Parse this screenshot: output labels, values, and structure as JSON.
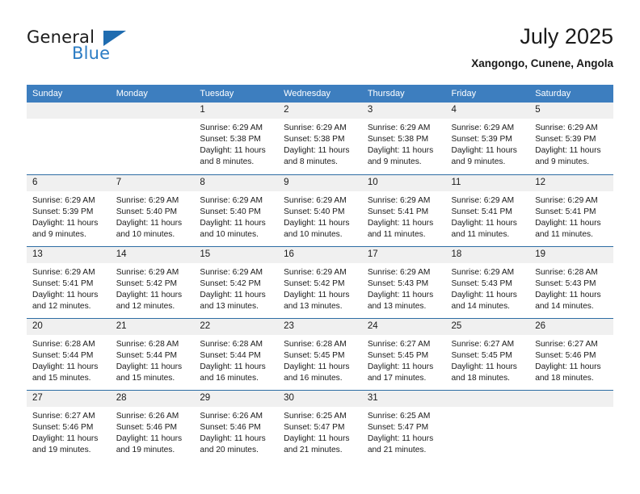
{
  "brand": {
    "line1": "General",
    "line2": "Blue",
    "triangle_icon": "brand-triangle-icon",
    "color_dark": "#1c1c1c",
    "color_blue": "#2b7cc4"
  },
  "header": {
    "title": "July 2025",
    "subtitle": "Xangongo, Cunene, Angola"
  },
  "theme": {
    "header_blue": "#3d7ebf",
    "row_rule_blue": "#2e6da4",
    "daynum_band": "#f0f0f0",
    "text": "#1a1a1a"
  },
  "calendar": {
    "weekday_headers": [
      "Sunday",
      "Monday",
      "Tuesday",
      "Wednesday",
      "Thursday",
      "Friday",
      "Saturday"
    ],
    "weeks": [
      [
        {
          "day": ""
        },
        {
          "day": ""
        },
        {
          "day": "1",
          "sunrise": "Sunrise: 6:29 AM",
          "sunset": "Sunset: 5:38 PM",
          "daylight": "Daylight: 11 hours and 8 minutes."
        },
        {
          "day": "2",
          "sunrise": "Sunrise: 6:29 AM",
          "sunset": "Sunset: 5:38 PM",
          "daylight": "Daylight: 11 hours and 8 minutes."
        },
        {
          "day": "3",
          "sunrise": "Sunrise: 6:29 AM",
          "sunset": "Sunset: 5:38 PM",
          "daylight": "Daylight: 11 hours and 9 minutes."
        },
        {
          "day": "4",
          "sunrise": "Sunrise: 6:29 AM",
          "sunset": "Sunset: 5:39 PM",
          "daylight": "Daylight: 11 hours and 9 minutes."
        },
        {
          "day": "5",
          "sunrise": "Sunrise: 6:29 AM",
          "sunset": "Sunset: 5:39 PM",
          "daylight": "Daylight: 11 hours and 9 minutes."
        }
      ],
      [
        {
          "day": "6",
          "sunrise": "Sunrise: 6:29 AM",
          "sunset": "Sunset: 5:39 PM",
          "daylight": "Daylight: 11 hours and 9 minutes."
        },
        {
          "day": "7",
          "sunrise": "Sunrise: 6:29 AM",
          "sunset": "Sunset: 5:40 PM",
          "daylight": "Daylight: 11 hours and 10 minutes."
        },
        {
          "day": "8",
          "sunrise": "Sunrise: 6:29 AM",
          "sunset": "Sunset: 5:40 PM",
          "daylight": "Daylight: 11 hours and 10 minutes."
        },
        {
          "day": "9",
          "sunrise": "Sunrise: 6:29 AM",
          "sunset": "Sunset: 5:40 PM",
          "daylight": "Daylight: 11 hours and 10 minutes."
        },
        {
          "day": "10",
          "sunrise": "Sunrise: 6:29 AM",
          "sunset": "Sunset: 5:41 PM",
          "daylight": "Daylight: 11 hours and 11 minutes."
        },
        {
          "day": "11",
          "sunrise": "Sunrise: 6:29 AM",
          "sunset": "Sunset: 5:41 PM",
          "daylight": "Daylight: 11 hours and 11 minutes."
        },
        {
          "day": "12",
          "sunrise": "Sunrise: 6:29 AM",
          "sunset": "Sunset: 5:41 PM",
          "daylight": "Daylight: 11 hours and 11 minutes."
        }
      ],
      [
        {
          "day": "13",
          "sunrise": "Sunrise: 6:29 AM",
          "sunset": "Sunset: 5:41 PM",
          "daylight": "Daylight: 11 hours and 12 minutes."
        },
        {
          "day": "14",
          "sunrise": "Sunrise: 6:29 AM",
          "sunset": "Sunset: 5:42 PM",
          "daylight": "Daylight: 11 hours and 12 minutes."
        },
        {
          "day": "15",
          "sunrise": "Sunrise: 6:29 AM",
          "sunset": "Sunset: 5:42 PM",
          "daylight": "Daylight: 11 hours and 13 minutes."
        },
        {
          "day": "16",
          "sunrise": "Sunrise: 6:29 AM",
          "sunset": "Sunset: 5:42 PM",
          "daylight": "Daylight: 11 hours and 13 minutes."
        },
        {
          "day": "17",
          "sunrise": "Sunrise: 6:29 AM",
          "sunset": "Sunset: 5:43 PM",
          "daylight": "Daylight: 11 hours and 13 minutes."
        },
        {
          "day": "18",
          "sunrise": "Sunrise: 6:29 AM",
          "sunset": "Sunset: 5:43 PM",
          "daylight": "Daylight: 11 hours and 14 minutes."
        },
        {
          "day": "19",
          "sunrise": "Sunrise: 6:28 AM",
          "sunset": "Sunset: 5:43 PM",
          "daylight": "Daylight: 11 hours and 14 minutes."
        }
      ],
      [
        {
          "day": "20",
          "sunrise": "Sunrise: 6:28 AM",
          "sunset": "Sunset: 5:44 PM",
          "daylight": "Daylight: 11 hours and 15 minutes."
        },
        {
          "day": "21",
          "sunrise": "Sunrise: 6:28 AM",
          "sunset": "Sunset: 5:44 PM",
          "daylight": "Daylight: 11 hours and 15 minutes."
        },
        {
          "day": "22",
          "sunrise": "Sunrise: 6:28 AM",
          "sunset": "Sunset: 5:44 PM",
          "daylight": "Daylight: 11 hours and 16 minutes."
        },
        {
          "day": "23",
          "sunrise": "Sunrise: 6:28 AM",
          "sunset": "Sunset: 5:45 PM",
          "daylight": "Daylight: 11 hours and 16 minutes."
        },
        {
          "day": "24",
          "sunrise": "Sunrise: 6:27 AM",
          "sunset": "Sunset: 5:45 PM",
          "daylight": "Daylight: 11 hours and 17 minutes."
        },
        {
          "day": "25",
          "sunrise": "Sunrise: 6:27 AM",
          "sunset": "Sunset: 5:45 PM",
          "daylight": "Daylight: 11 hours and 18 minutes."
        },
        {
          "day": "26",
          "sunrise": "Sunrise: 6:27 AM",
          "sunset": "Sunset: 5:46 PM",
          "daylight": "Daylight: 11 hours and 18 minutes."
        }
      ],
      [
        {
          "day": "27",
          "sunrise": "Sunrise: 6:27 AM",
          "sunset": "Sunset: 5:46 PM",
          "daylight": "Daylight: 11 hours and 19 minutes."
        },
        {
          "day": "28",
          "sunrise": "Sunrise: 6:26 AM",
          "sunset": "Sunset: 5:46 PM",
          "daylight": "Daylight: 11 hours and 19 minutes."
        },
        {
          "day": "29",
          "sunrise": "Sunrise: 6:26 AM",
          "sunset": "Sunset: 5:46 PM",
          "daylight": "Daylight: 11 hours and 20 minutes."
        },
        {
          "day": "30",
          "sunrise": "Sunrise: 6:25 AM",
          "sunset": "Sunset: 5:47 PM",
          "daylight": "Daylight: 11 hours and 21 minutes."
        },
        {
          "day": "31",
          "sunrise": "Sunrise: 6:25 AM",
          "sunset": "Sunset: 5:47 PM",
          "daylight": "Daylight: 11 hours and 21 minutes."
        },
        {
          "day": ""
        },
        {
          "day": ""
        }
      ]
    ]
  }
}
